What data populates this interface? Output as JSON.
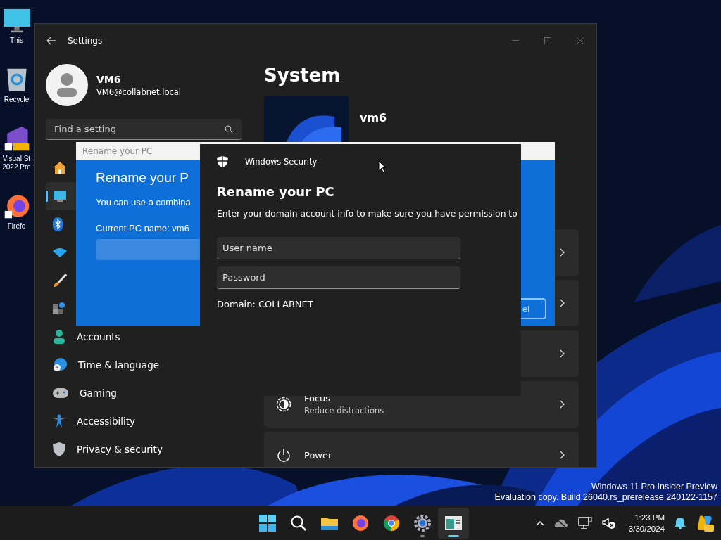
{
  "desktop_icons": [
    {
      "lines": [
        "This"
      ]
    },
    {
      "lines": [
        "Recycle"
      ]
    },
    {
      "lines": [
        "Visual St",
        "2022 Pre"
      ]
    },
    {
      "lines": [
        "Firefo"
      ]
    }
  ],
  "settings": {
    "title": "Settings",
    "user": {
      "name": "VM6",
      "email": "VM6@collabnet.local"
    },
    "search": {
      "placeholder": "Find a setting"
    },
    "nav": [
      {
        "selected": false
      },
      {
        "selected": true
      },
      {
        "selected": false
      },
      {
        "selected": false
      },
      {
        "selected": false
      },
      {
        "selected": false
      },
      {
        "label": "Accounts",
        "selected": false
      },
      {
        "label": "Time & language",
        "selected": false
      },
      {
        "label": "Gaming",
        "selected": false
      },
      {
        "label": "Accessibility",
        "selected": false
      },
      {
        "label": "Privacy & security",
        "selected": false
      }
    ],
    "heading": "System",
    "pc_name": "vm6",
    "cards": [
      {
        "title": "Focus",
        "subtitle": "Reduce distractions"
      },
      {
        "title": "Power"
      }
    ]
  },
  "rename_window": {
    "title": "Rename your PC",
    "heading": "Rename your P",
    "text": "You can use a combina",
    "current": "Current PC name: vm6",
    "button": "el"
  },
  "security_dialog": {
    "app": "Windows Security",
    "heading": "Rename your PC",
    "text": "Enter your domain account info to make sure you have permission to",
    "fields": [
      {
        "placeholder": "User name"
      },
      {
        "placeholder": "Password"
      }
    ],
    "domain": "Domain: COLLABNET"
  },
  "watermark": [
    "Windows 11 Pro Insider Preview",
    "Evaluation copy. Build 26040.rs_prerelease.240122-1157"
  ],
  "taskbar": {
    "apps": [
      {
        "running": false,
        "active": false
      },
      {
        "running": false,
        "active": false
      },
      {
        "running": false,
        "active": false
      },
      {
        "running": false,
        "active": false
      },
      {
        "running": false,
        "active": false
      },
      {
        "running": true,
        "active": false
      },
      {
        "running": true,
        "active": true
      }
    ],
    "time": "1:23 PM",
    "date": "3/30/2024"
  }
}
